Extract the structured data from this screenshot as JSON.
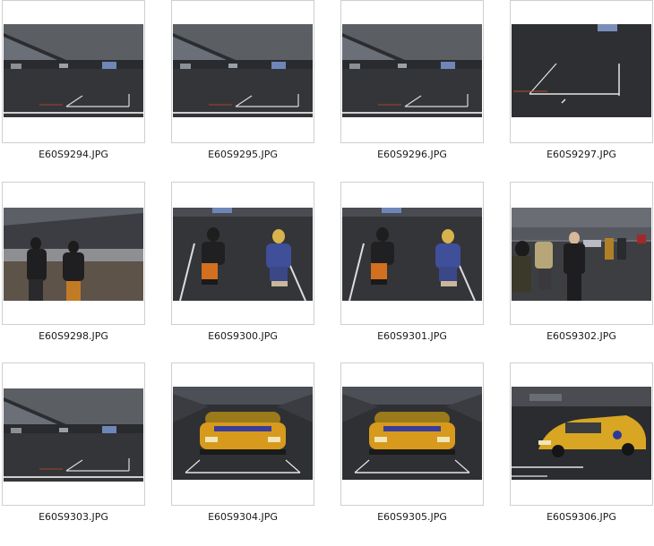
{
  "files": [
    {
      "name": "E60S9294.JPG",
      "scene": "grid-stands"
    },
    {
      "name": "E60S9295.JPG",
      "scene": "grid-stands"
    },
    {
      "name": "E60S9296.JPG",
      "scene": "grid-stands"
    },
    {
      "name": "E60S9297.JPG",
      "scene": "grid-box"
    },
    {
      "name": "E60S9298.JPG",
      "scene": "people-walking"
    },
    {
      "name": "E60S9300.JPG",
      "scene": "people-sitting"
    },
    {
      "name": "E60S9301.JPG",
      "scene": "people-sitting"
    },
    {
      "name": "E60S9302.JPG",
      "scene": "people-standing"
    },
    {
      "name": "E60S9303.JPG",
      "scene": "grid-stands"
    },
    {
      "name": "E60S9304.JPG",
      "scene": "yellow-car-front"
    },
    {
      "name": "E60S9305.JPG",
      "scene": "yellow-car-front"
    },
    {
      "name": "E60S9306.JPG",
      "scene": "yellow-car-side"
    }
  ]
}
